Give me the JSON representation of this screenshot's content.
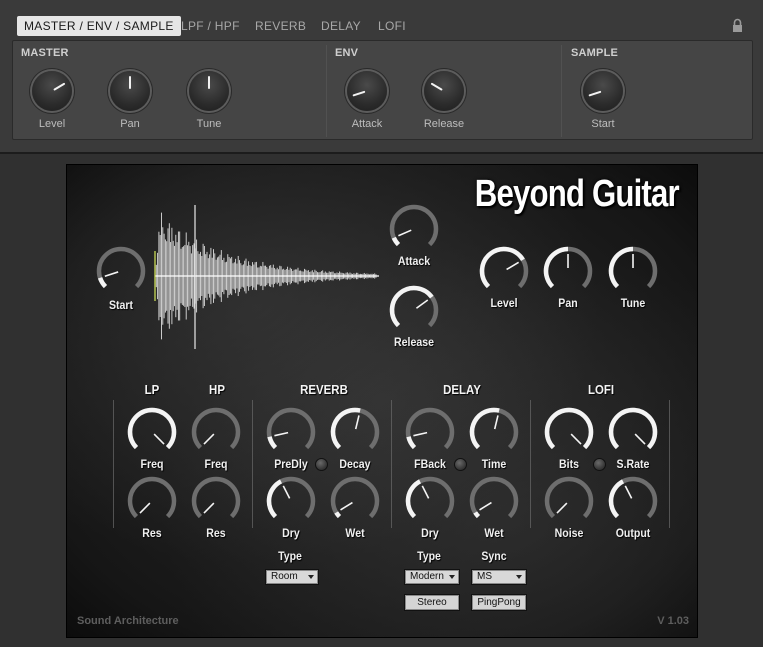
{
  "host": {
    "tabs": [
      "MASTER / ENV / SAMPLE",
      "LPF / HPF",
      "REVERB",
      "DELAY",
      "LOFI"
    ],
    "sections": [
      "MASTER",
      "ENV",
      "SAMPLE"
    ],
    "knobs": [
      {
        "label": "Level",
        "value": 0.72
      },
      {
        "label": "Pan",
        "value": 0.5
      },
      {
        "label": "Tune",
        "value": 0.5
      },
      {
        "label": "Attack",
        "value": 0.1
      },
      {
        "label": "Release",
        "value": 0.28
      },
      {
        "label": "Start",
        "value": 0.1
      }
    ]
  },
  "instrument": {
    "title": "Beyond Guitar",
    "footer_left": "Sound Architecture",
    "footer_right": "V 1.03",
    "top_knobs": [
      {
        "label": "Start",
        "value": 0.1
      },
      {
        "label": "Attack",
        "value": 0.08
      },
      {
        "label": "Release",
        "value": 0.7
      },
      {
        "label": "Level",
        "value": 0.72
      },
      {
        "label": "Pan",
        "value": 0.5
      },
      {
        "label": "Tune",
        "value": 0.5
      }
    ],
    "groups": [
      "LP",
      "HP",
      "REVERB",
      "DELAY",
      "LOFI"
    ],
    "filter_knobs": [
      {
        "label": "Freq",
        "value": 1.0
      },
      {
        "label": "Freq",
        "value": 0.0
      },
      {
        "label": "Res",
        "value": 0.0
      },
      {
        "label": "Res",
        "value": 0.0
      }
    ],
    "reverb_knobs": [
      {
        "label": "PreDly",
        "value": 0.12
      },
      {
        "label": "Decay",
        "value": 0.55
      },
      {
        "label": "Dry",
        "value": 0.4
      },
      {
        "label": "Wet",
        "value": 0.05
      }
    ],
    "delay_knobs": [
      {
        "label": "FBack",
        "value": 0.12
      },
      {
        "label": "Time",
        "value": 0.55
      },
      {
        "label": "Dry",
        "value": 0.4
      },
      {
        "label": "Wet",
        "value": 0.05
      }
    ],
    "lofi_knobs": [
      {
        "label": "Bits",
        "value": 1.0
      },
      {
        "label": "S.Rate",
        "value": 1.0
      },
      {
        "label": "Noise",
        "value": 0.0
      },
      {
        "label": "Output",
        "value": 0.4
      }
    ],
    "reverb_type": {
      "label": "Type",
      "value": "Room"
    },
    "delay_type": {
      "label": "Type",
      "value": "Modern"
    },
    "delay_sync": {
      "label": "Sync",
      "value": "MS"
    },
    "buttons": [
      "Stereo",
      "PingPong"
    ]
  }
}
